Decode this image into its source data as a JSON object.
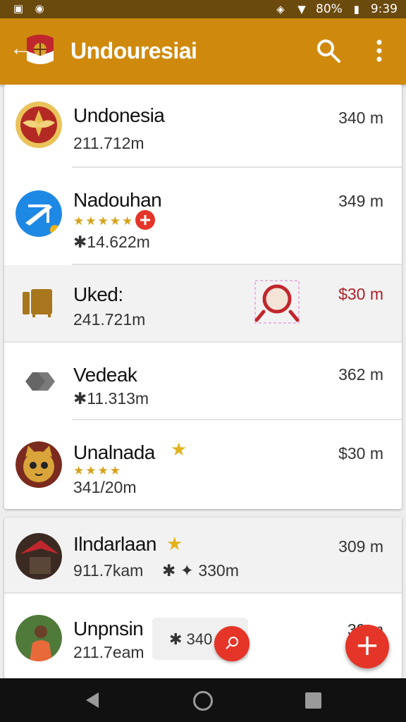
{
  "status_bar": {
    "battery": "80%",
    "time": "9:39",
    "icons": [
      "image-icon",
      "globe-icon",
      "nfc-icon",
      "wifi-icon",
      "battery-icon"
    ]
  },
  "app_bar": {
    "title": "Undouresiai",
    "icons": [
      "back-icon",
      "flag-emblem-icon",
      "search-icon",
      "more-vert-icon"
    ]
  },
  "colors": {
    "app_bar": "#cf8a0e",
    "status_bar": "#6b4a0e",
    "fab": "#e53528",
    "red_value": "#b0212a",
    "star": "#e3b21c"
  },
  "list": [
    {
      "name": "Undonesia",
      "sub": "211.712m",
      "value": "340 m",
      "avatar": "garuda-emblem-icon"
    },
    {
      "name": "Nadouhan",
      "rating_stars": "★★★★★",
      "sub": "✱14.622m",
      "value": "349 m",
      "avatar": "blue-app-icon"
    },
    {
      "name": "Uked:",
      "sub": "241.721m",
      "value": "$30 m",
      "avatar": "brown-folder-icon",
      "highlight": true
    },
    {
      "name": "Vedeak",
      "sub": "✱11.313m",
      "value": "362 m",
      "avatar": "gray-shape-icon"
    },
    {
      "name": "Unalnada",
      "rating_stars": "★★★★",
      "sub": "341/20m",
      "value": "$30 m",
      "avatar": "cat-avatar-icon"
    }
  ],
  "list2": [
    {
      "name": "Ilndarlaan",
      "sub": "911.7kam",
      "sub_extra": "✱ ✦ 330m",
      "value": "309 m",
      "avatar": "red-roof-icon"
    },
    {
      "name": "Unpnsin",
      "sub": "211.7eam",
      "value": "39 m",
      "avatar": "person-photo-icon"
    }
  ],
  "chip": {
    "text": "✱ 340"
  },
  "fab": {
    "label": "+"
  },
  "nav": {
    "items": [
      "nav-back-icon",
      "nav-home-icon",
      "nav-recent-icon"
    ]
  }
}
